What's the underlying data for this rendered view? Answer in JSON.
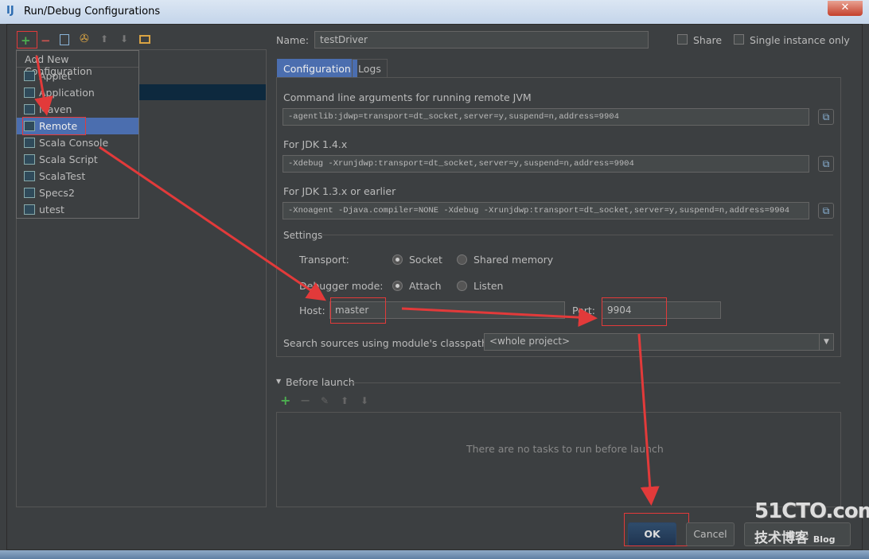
{
  "window": {
    "title": "Run/Debug Configurations",
    "app_icon": "intellij-icon",
    "close": "✕"
  },
  "toolbar": {
    "icons": [
      "add-icon",
      "remove-icon",
      "copy-icon",
      "wrench-icon",
      "arrow-up-icon",
      "arrow-down-icon",
      "folder-icon"
    ],
    "add": "+",
    "remove": "−",
    "up": "⬆",
    "down": "⬇"
  },
  "popup": {
    "header": "Add New Configuration",
    "items": [
      {
        "label": "Applet"
      },
      {
        "label": "Application"
      },
      {
        "label": "Maven"
      },
      {
        "label": "Remote",
        "selected": true
      },
      {
        "label": "Scala Console"
      },
      {
        "label": "Scala Script"
      },
      {
        "label": "ScalaTest"
      },
      {
        "label": "Specs2"
      },
      {
        "label": "utest"
      }
    ]
  },
  "config": {
    "name_label": "Name:",
    "name_value": "testDriver",
    "share": "Share",
    "single_instance": "Single instance only",
    "tabs": [
      "Configuration",
      "Logs"
    ],
    "cmd_label": "Command line arguments for running remote JVM",
    "cmd_value": "-agentlib:jdwp=transport=dt_socket,server=y,suspend=n,address=9904",
    "jdk14_label": "For JDK 1.4.x",
    "jdk14_value": "-Xdebug -Xrunjdwp:transport=dt_socket,server=y,suspend=n,address=9904",
    "jdk13_label": "For JDK 1.3.x or earlier",
    "jdk13_value": "-Xnoagent -Djava.compiler=NONE -Xdebug -Xrunjdwp:transport=dt_socket,server=y,suspend=n,address=9904",
    "settings_label": "Settings",
    "transport_label": "Transport:",
    "transport_options": [
      "Socket",
      "Shared memory"
    ],
    "transport_selected": "Socket",
    "debugger_label": "Debugger mode:",
    "debugger_options": [
      "Attach",
      "Listen"
    ],
    "debugger_selected": "Attach",
    "host_label": "Host:",
    "host_value": "master",
    "port_label": "Port:",
    "port_value": "9904",
    "classpath_label": "Search sources using module's classpath:",
    "classpath_value": "<whole project>"
  },
  "before_launch": {
    "title": "Before launch",
    "empty_text": "There are no tasks to run before launch"
  },
  "buttons": {
    "ok": "OK",
    "cancel": "Cancel",
    "help": "Help"
  },
  "watermark": {
    "text": "51CTO.com",
    "sub": "技术博客",
    "blog": "Blog"
  },
  "annotation_color": "#e23a3a"
}
